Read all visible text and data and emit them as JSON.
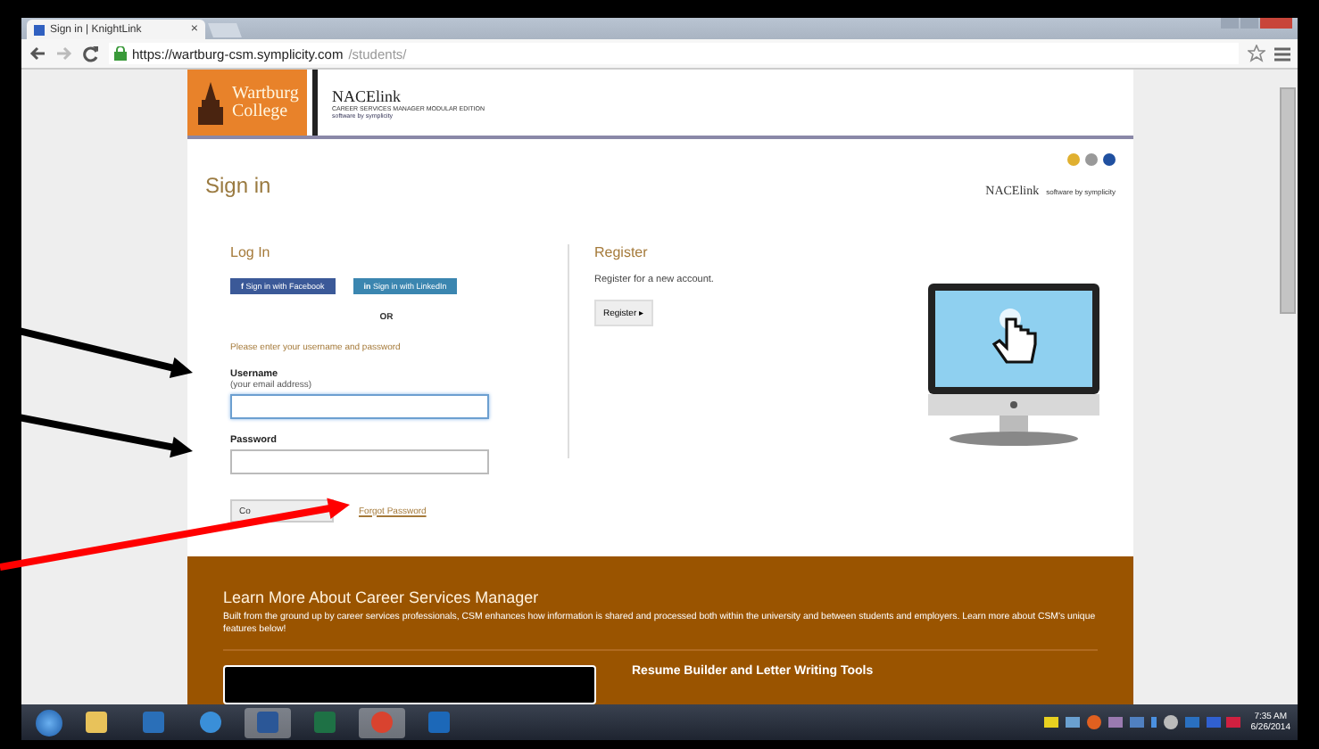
{
  "browser": {
    "tab": {
      "title": "Sign in | KnightLink",
      "close": "×"
    },
    "url": {
      "host": "https://wartburg-csm.symplicity.com",
      "path": "/students/"
    }
  },
  "header": {
    "college_logo": [
      "Wartburg",
      "College"
    ],
    "product_logo": "NACElink",
    "product_subtitle": "CAREER SERVICES MANAGER MODULAR EDITION",
    "vendor": "software by symplicity"
  },
  "page": {
    "title": "Sign in",
    "brand": "NACElink",
    "brand_vendor": "software by symplicity"
  },
  "login": {
    "heading": "Log In",
    "social_buttons": [
      {
        "label": "Sign in with Facebook",
        "kind": "facebook",
        "mark": "f"
      },
      {
        "label": "Sign in with LinkedIn",
        "kind": "linkedin",
        "mark": "in"
      }
    ],
    "separator": "OR",
    "prompt": "Please enter your username and password",
    "fields": [
      {
        "label": "Username",
        "hint": "(your email address)",
        "focused": true
      },
      {
        "label": "Password",
        "focused": false
      }
    ],
    "submit": "Co",
    "forgot_link": "Forgot Password"
  },
  "register": {
    "heading": "Register",
    "text": "Register for a new account.",
    "button": "Register ▸"
  },
  "promo": {
    "title": "Learn More About Career Services Manager",
    "text": "Built from the ground up by career services professionals, CSM enhances how information is shared and processed both within the university and between students and employers. Learn more about CSM's unique features below!",
    "feature_title": "Resume Builder and Letter Writing Tools"
  },
  "taskbar": {
    "apps": [
      {
        "kind": "folder",
        "selected": false
      },
      {
        "kind": "lync",
        "selected": false
      },
      {
        "kind": "ie",
        "selected": false
      },
      {
        "kind": "word",
        "selected": true
      },
      {
        "kind": "excel",
        "selected": false
      },
      {
        "kind": "chrome",
        "selected": true
      },
      {
        "kind": "outlook",
        "selected": false
      }
    ],
    "time": "7:35 AM",
    "date": "6/26/2014"
  },
  "annotations": [
    {
      "color": "#000000"
    },
    {
      "color": "#000000"
    },
    {
      "color": "#ff0000"
    }
  ]
}
